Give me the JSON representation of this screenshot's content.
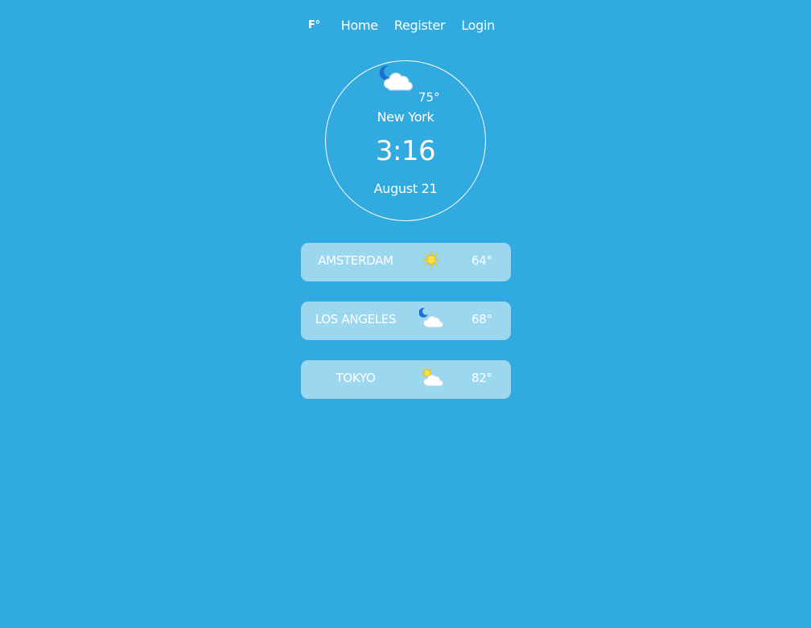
{
  "nav": {
    "unit_toggle": "F°",
    "links": [
      "Home",
      "Register",
      "Login"
    ]
  },
  "current": {
    "icon": "moon-cloud-icon",
    "temperature": "75°",
    "city": "New York",
    "time": "3:16",
    "date": "August 21"
  },
  "cities": [
    {
      "name": "AMSTERDAM",
      "icon": "sun-icon",
      "temperature": "64°"
    },
    {
      "name": "LOS ANGELES",
      "icon": "moon-cloud-icon",
      "temperature": "68°"
    },
    {
      "name": "TOKYO",
      "icon": "sun-cloud-icon",
      "temperature": "82°"
    }
  ],
  "colors": {
    "background": "#31aadf",
    "card": "#9cd7f0",
    "moon": "#1f6fd0",
    "sun": "#f5c400"
  }
}
